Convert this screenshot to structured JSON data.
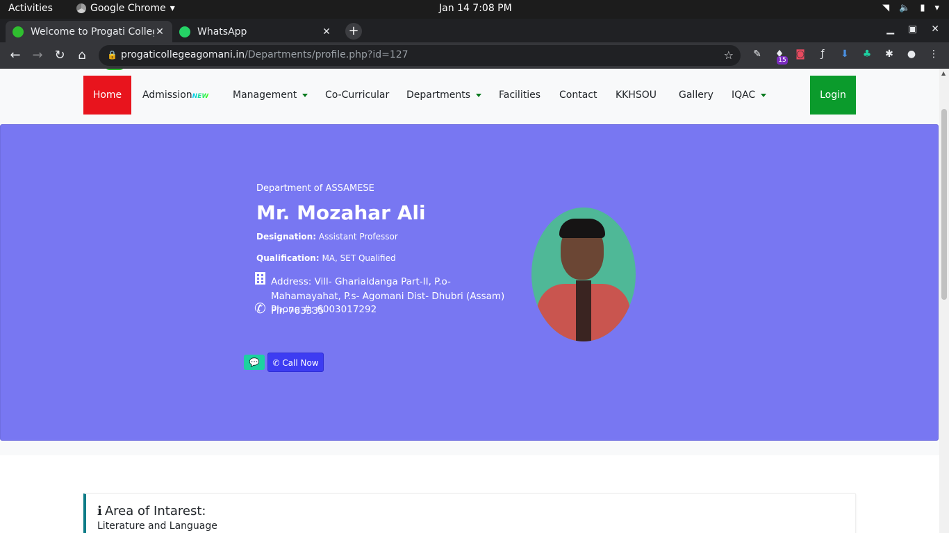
{
  "system": {
    "activities": "Activities",
    "app_name": "Google Chrome",
    "clock": "Jan 14  7:08 PM"
  },
  "browser": {
    "tabs": [
      {
        "title": "Welcome to Progati College",
        "active": true,
        "favicon_color": "#2fbf2f"
      },
      {
        "title": "WhatsApp",
        "active": false,
        "favicon_color": "#25d366"
      }
    ],
    "url_host": "progaticollegeagomani.in",
    "url_path": "/Departments/profile.php?id=127",
    "extension_badge": "15"
  },
  "nav": {
    "home": "Home",
    "admission": "Admission",
    "admission_badge": "NEW",
    "management": "Management",
    "co_curricular": "Co-Curricular",
    "departments": "Departments",
    "facilities": "Facilities",
    "contact": "Contact",
    "kkhsou": "KKHSOU",
    "gallery": "Gallery",
    "iqac": "IQAC",
    "login": "Login"
  },
  "profile": {
    "department": "Department of ASSAMESE",
    "name": "Mr. Mozahar Ali",
    "designation_label": "Designation:",
    "designation": "Assistant Professor",
    "qualification_label": "Qualification:",
    "qualification": "MA, SET Qualified",
    "address": "Address: Vill- Gharialdanga Part-II, P.o- Mahamayahat, P.s- Agomani Dist- Dhubri (Assam) Pin-783335",
    "phone": "Phone #: 6003017292",
    "call_button": "Call Now"
  },
  "interest": {
    "heading": "Area of Intarest:",
    "text": "Literature and Language"
  },
  "colors": {
    "hero_bg": "#7877f2",
    "home_bg": "#e8141d",
    "login_bg": "#0b9b2c",
    "call_btn": "#3d3cf2",
    "chat_btn": "#1dd1a1"
  }
}
